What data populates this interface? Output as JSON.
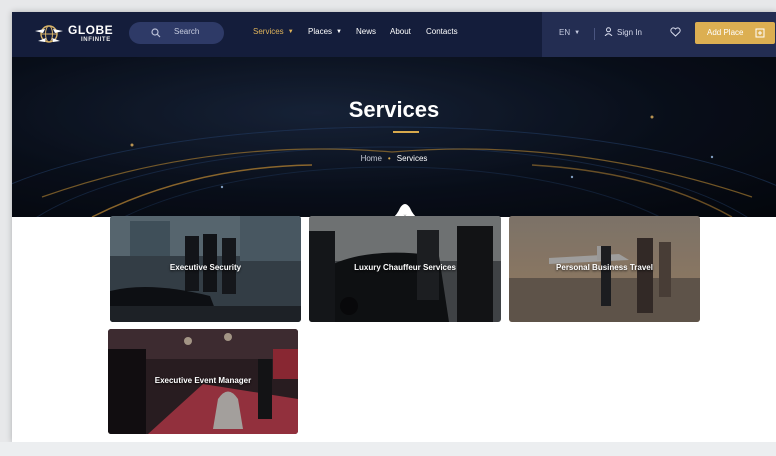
{
  "header": {
    "logo": {
      "line1": "GLOBE",
      "line2": "INFINITE",
      "icon": "globe-icon"
    },
    "search": {
      "label": "Search",
      "icon": "search-icon"
    },
    "nav": [
      {
        "label": "Services",
        "active": true,
        "dropdown": true
      },
      {
        "label": "Places",
        "active": false,
        "dropdown": true
      },
      {
        "label": "News",
        "active": false,
        "dropdown": false
      },
      {
        "label": "About",
        "active": false,
        "dropdown": false
      },
      {
        "label": "Contacts",
        "active": false,
        "dropdown": false
      }
    ],
    "language": "EN",
    "signin_label": "Sign In",
    "add_place_label": "Add Place"
  },
  "hero": {
    "title": "Services",
    "breadcrumb": {
      "home": "Home",
      "current": "Services"
    }
  },
  "services": [
    {
      "title": "Executive Security"
    },
    {
      "title": "Luxury Chauffeur Services"
    },
    {
      "title": "Personal Business Travel"
    },
    {
      "title": "Executive Event Manager"
    }
  ],
  "colors": {
    "header_bg": "#141d3b",
    "accent": "#dcaf52",
    "active_nav": "#e0b45a"
  }
}
